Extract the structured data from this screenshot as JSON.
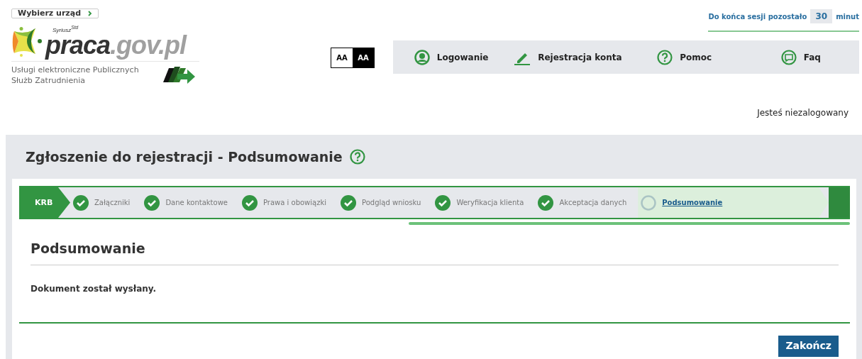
{
  "header": {
    "office_button": "Wybierz urząd",
    "logo": {
      "superscript": "Syriusz$^{Std}$",
      "name_main": "praca",
      "name_domain": ".gov.pl"
    },
    "tagline": "Usługi elektroniczne Publicznych Służb Zatrudnienia",
    "contrast": [
      {
        "label": "AA",
        "selected": false
      },
      {
        "label": "AA",
        "selected": true
      }
    ],
    "session": {
      "prefix": "Do końca sesji pozostało",
      "minutes": "30",
      "suffix": "minut"
    },
    "nav": [
      {
        "label": "Logowanie",
        "kind": "user"
      },
      {
        "label": "Rejestracja konta",
        "kind": "pencil"
      },
      {
        "label": "Pomoc",
        "kind": "help"
      },
      {
        "label": "Faq",
        "kind": "chat"
      }
    ],
    "login_status": "Jesteś niezalogowany"
  },
  "page": {
    "title": "Zgłoszenie do rejestracji - Podsumowanie",
    "wizard": {
      "start": "KRB",
      "steps": [
        {
          "label": "Załączniki",
          "selected": false,
          "done": true
        },
        {
          "label": "Dane kontaktowe",
          "selected": false,
          "done": true
        },
        {
          "label": "Prawa i obowiązki",
          "selected": false,
          "done": true
        },
        {
          "label": "Podgląd wniosku",
          "selected": false,
          "done": true
        },
        {
          "label": "Weryfikacja klienta",
          "selected": false,
          "done": true
        },
        {
          "label": "Akceptacja danych",
          "selected": false,
          "done": true
        },
        {
          "label": "Podsumowanie",
          "selected": true,
          "done": false
        }
      ]
    },
    "section_title": "Podsumowanie",
    "message": "Dokument został wysłany.",
    "buttons": [
      "Zakończ"
    ]
  }
}
